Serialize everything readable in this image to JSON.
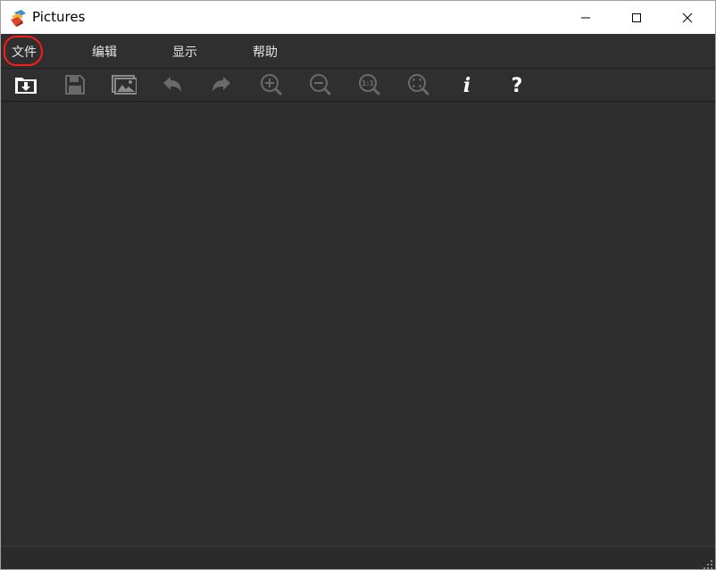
{
  "window": {
    "title": "Pictures"
  },
  "menu": {
    "items": [
      {
        "label": "文件"
      },
      {
        "label": "编辑"
      },
      {
        "label": "显示"
      },
      {
        "label": "帮助"
      }
    ],
    "highlighted_item": "文件"
  },
  "toolbar": {
    "buttons": [
      {
        "icon": "open-folder-icon"
      },
      {
        "icon": "save-icon"
      },
      {
        "icon": "image-icon"
      },
      {
        "icon": "undo-icon"
      },
      {
        "icon": "redo-icon"
      },
      {
        "icon": "zoom-in-icon"
      },
      {
        "icon": "zoom-out-icon"
      },
      {
        "icon": "actual-size-icon",
        "text": "1:1"
      },
      {
        "icon": "fit-to-window-icon"
      },
      {
        "icon": "info-icon",
        "text": "i"
      },
      {
        "icon": "help-icon",
        "text": "?"
      }
    ]
  },
  "colors": {
    "background": "#2b2b2b",
    "menubar": "#2f2f2f",
    "menu_text": "#e6e6e6",
    "icon_active": "#ffffff",
    "icon_disabled": "#6a6a6a",
    "highlight": "#ff1a1a"
  }
}
